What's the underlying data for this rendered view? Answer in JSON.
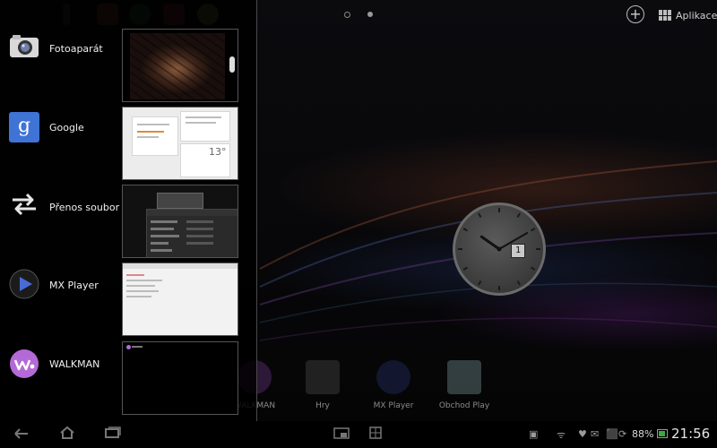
{
  "top_bar": {
    "apps_label": "Aplikace",
    "add_icon": "plus-circle-icon",
    "apps_icon": "grid-icon",
    "page_indicator_count": 2,
    "active_page_index": 1
  },
  "recent_apps": [
    {
      "label": "Fotoaparát",
      "icon": "camera-icon"
    },
    {
      "label": "Google",
      "icon": "google-icon"
    },
    {
      "label": "Přenos soubor",
      "icon": "transfer-arrows-icon"
    },
    {
      "label": "MX Player",
      "icon": "mx-player-icon"
    },
    {
      "label": "WALKMAN",
      "icon": "walkman-icon"
    }
  ],
  "google_thumb": {
    "temperature": "13°"
  },
  "clock_widget": {
    "date_day": "1",
    "hour": 10,
    "minute": 10
  },
  "dock": [
    {
      "label": "WALKMAN",
      "icon": "walkman-icon"
    },
    {
      "label": "Hry",
      "icon": "games-icon"
    },
    {
      "label": "MX Player",
      "icon": "mx-player-icon"
    },
    {
      "label": "Obchod Play",
      "icon": "play-store-icon"
    }
  ],
  "status_bar": {
    "battery_percent": "88%",
    "time": "21:56"
  },
  "colors": {
    "background": "#000000",
    "battery_fill": "#39a845",
    "google_blue": "#3f74d6",
    "walkman_purple": "#b46ad6"
  }
}
